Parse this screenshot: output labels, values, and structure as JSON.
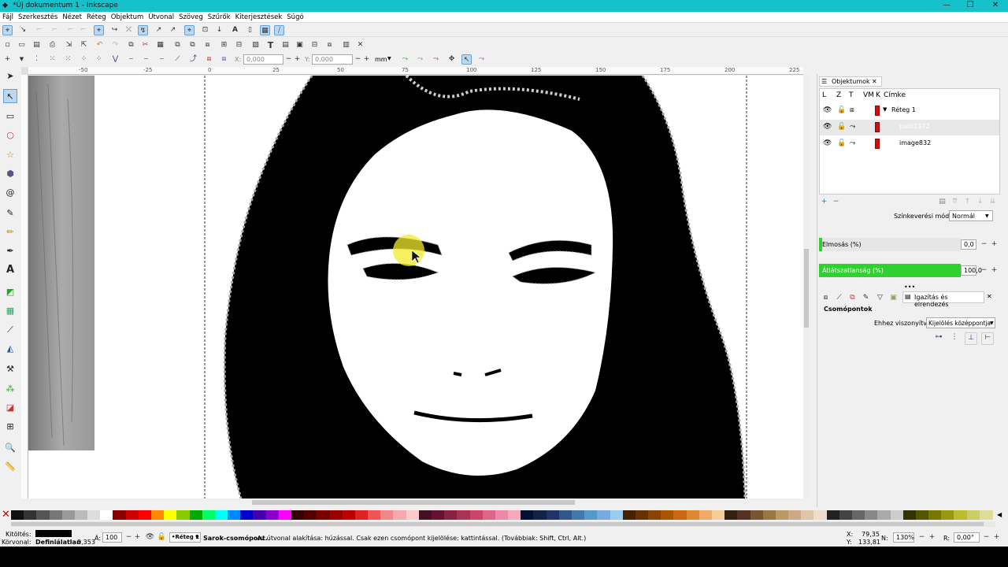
{
  "window": {
    "title": "*Új dokumentum 1 - Inkscape",
    "minimize": "—",
    "restore": "❐",
    "close": "✕"
  },
  "menu": [
    "Fájl",
    "Szerkesztés",
    "Nézet",
    "Réteg",
    "Objektum",
    "Útvonal",
    "Szöveg",
    "Szűrők",
    "Kiterjesztések",
    "Súgó"
  ],
  "toolcontrols": {
    "x_label": "X:",
    "x_value": "0,000",
    "y_label": "Y:",
    "y_value": "0,000",
    "unit": "mm"
  },
  "ruler": {
    "labels": [
      "-50",
      "-25",
      "0",
      "25",
      "50",
      "75",
      "100",
      "125",
      "150",
      "175",
      "200",
      "225"
    ]
  },
  "objects_panel": {
    "title": "Objektumok",
    "columns": [
      "L",
      "Z",
      "T",
      "VM",
      "K",
      "Címke"
    ],
    "rows": [
      {
        "label": "Réteg 1",
        "color": "#cc1111",
        "expanded": true
      },
      {
        "label": "path1072",
        "color": "#cc1111",
        "selected": true
      },
      {
        "label": "image832",
        "color": "#cc1111"
      }
    ],
    "blend_label": "Színkeverési mód:",
    "blend_value": "Normál",
    "blur_label": "Elmosás (%)",
    "blur_value": "0,0",
    "opacity_label": "Átlátszatlanság (%)",
    "opacity_value": "100,0",
    "opacity_level": 1.0,
    "accent": "#2ed12e"
  },
  "align_panel": {
    "tab_label": "Igazítás és elrendezés",
    "section": "Csomópontok",
    "relative_label": "Ehhez viszonyítva:",
    "relative_value": "Kijelölés középpontja"
  },
  "status": {
    "fill_label": "Kitöltés:",
    "stroke_label": "Körvonal:",
    "stroke_value": "Definiálatlan",
    "stroke_width": "0,353",
    "opacity_label": "Á:",
    "opacity_value": "100",
    "layer": "•Réteg 1",
    "message_bold": "Sarok-csomópont.",
    "message": " Az útvonal alakítása: húzással. Csak ezen csomópont kijelölése: kattintással. (Továbbiak: Shift, Ctrl, Alt.)",
    "x_label": "X:",
    "x_value": "79,35",
    "y_label": "Y:",
    "y_value": "133,81",
    "zoom_label": "N:",
    "zoom_value": "130%",
    "rot_label": "R:",
    "rot_value": "0,00°"
  },
  "palette_colors": [
    "#111111",
    "#333333",
    "#555555",
    "#777777",
    "#999999",
    "#bbbbbb",
    "#dddddd",
    "#ffffff",
    "#880000",
    "#cc0000",
    "#ff0000",
    "#ff8800",
    "#ffff00",
    "#88cc00",
    "#00aa00",
    "#00ff66",
    "#00ffff",
    "#0088ff",
    "#0000cc",
    "#4400aa",
    "#8800cc",
    "#ff00ff",
    "#330000",
    "#550000",
    "#770000",
    "#990000",
    "#bb0000",
    "#dd2222",
    "#ee5555",
    "#f08888",
    "#f4aaaa",
    "#f8cccc",
    "#441122",
    "#661133",
    "#882244",
    "#aa3355",
    "#cc4466",
    "#dd6688",
    "#ee88aa",
    "#f4aabb",
    "#001133",
    "#112244",
    "#223366",
    "#335588",
    "#4477aa",
    "#5599cc",
    "#77aadd",
    "#99ccee",
    "#442200",
    "#663300",
    "#884400",
    "#aa5500",
    "#cc6611",
    "#dd8833",
    "#eeaa66",
    "#f4cc99",
    "#332211",
    "#553322",
    "#775533",
    "#997744",
    "#bb9966",
    "#ccaa88",
    "#ddc4aa",
    "#eeddcc",
    "#222222",
    "#444444",
    "#666666",
    "#888888",
    "#aaaaaa",
    "#cccccc",
    "#333300",
    "#555500",
    "#777700",
    "#999911",
    "#bbbb33",
    "#cccc66",
    "#dddd99"
  ]
}
